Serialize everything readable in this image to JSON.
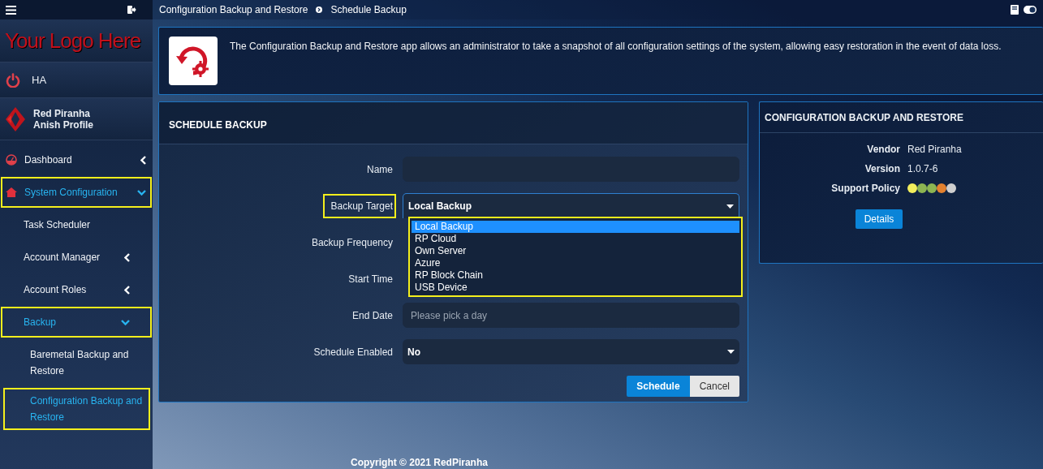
{
  "sidebar": {
    "logo": "Your Logo Here",
    "device": "HA",
    "profile": {
      "name": "Red Piranha",
      "subtitle": "Anish Profile"
    },
    "items": [
      {
        "label": "Dashboard",
        "expanded": false,
        "active": false,
        "highlighted": false
      },
      {
        "label": "System Configuration",
        "expanded": true,
        "active": true,
        "highlighted": true,
        "children": [
          {
            "label": "Task Scheduler",
            "active": false,
            "highlighted": false
          },
          {
            "label": "Account Manager",
            "expanded": false,
            "active": false,
            "highlighted": false
          },
          {
            "label": "Account Roles",
            "expanded": false,
            "active": false,
            "highlighted": false
          },
          {
            "label": "Backup",
            "expanded": true,
            "active": true,
            "highlighted": true,
            "children": [
              {
                "label": "Baremetal Backup and Restore",
                "active": false,
                "highlighted": false
              },
              {
                "label": "Configuration Backup and Restore",
                "active": true,
                "highlighted": true
              }
            ]
          }
        ]
      }
    ]
  },
  "breadcrumb": [
    "Configuration Backup and Restore",
    "Schedule Backup"
  ],
  "info": {
    "description": "The Configuration Backup and Restore app allows an administrator to take a snapshot of all configuration settings of the system, allowing easy restoration in the event of data loss."
  },
  "form": {
    "title": "SCHEDULE BACKUP",
    "fields": [
      {
        "label": "Name",
        "kind": "text",
        "highlighted": false
      },
      {
        "label": "Backup Target",
        "kind": "select",
        "value": "Local Backup",
        "highlighted": true,
        "open": true,
        "options": [
          {
            "label": "Local Backup",
            "selected": true
          },
          {
            "label": "RP Cloud",
            "selected": false
          },
          {
            "label": "Own Server",
            "selected": false
          },
          {
            "label": "Azure",
            "selected": false
          },
          {
            "label": "RP Block Chain",
            "selected": false
          },
          {
            "label": "USB Device",
            "selected": false
          }
        ]
      },
      {
        "label": "Backup Frequency",
        "kind": "covered",
        "highlighted": false
      },
      {
        "label": "Start Time",
        "kind": "covered",
        "highlighted": false
      },
      {
        "label": "End Date",
        "kind": "text",
        "placeholder": "Please pick a day",
        "highlighted": false
      },
      {
        "label": "Schedule Enabled",
        "kind": "select",
        "value": "No",
        "highlighted": false,
        "open": false
      }
    ],
    "buttons": [
      {
        "label": "Schedule",
        "kind": "primary"
      },
      {
        "label": "Cancel",
        "kind": "secondary"
      }
    ]
  },
  "app_card": {
    "title": "CONFIGURATION BACKUP AND RESTORE",
    "rows": [
      {
        "label": "Vendor",
        "value": "Red Piranha"
      },
      {
        "label": "Version",
        "value": "1.0.7-6"
      }
    ],
    "support_policy": {
      "label": "Support Policy",
      "dots": [
        {
          "color": "#f2ee5c"
        },
        {
          "color": "#8db552"
        },
        {
          "color": "#8db552"
        },
        {
          "color": "#e3812f"
        },
        {
          "color": "#cfcfcf"
        }
      ]
    },
    "button": "Details"
  },
  "footer": "Copyright © 2021 RedPiranha"
}
